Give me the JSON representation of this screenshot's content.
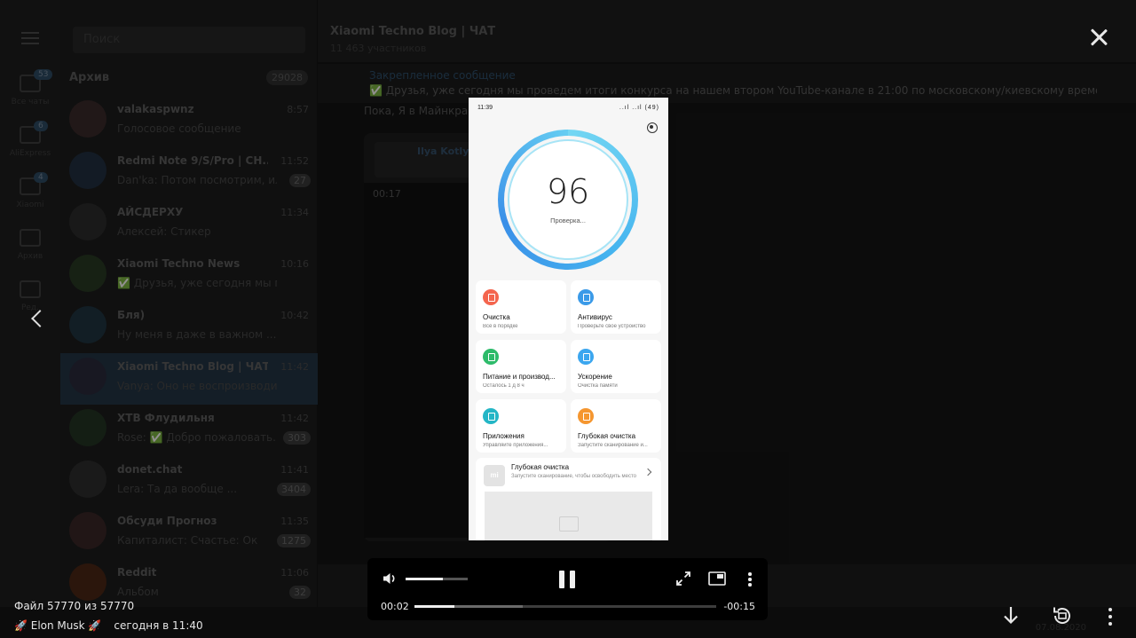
{
  "telegram_background": {
    "sidebar_folders": [
      {
        "label": "Все чаты",
        "badge": "53"
      },
      {
        "label": "AliExpress",
        "badge": "6"
      },
      {
        "label": "Xiaomi",
        "badge": "4"
      },
      {
        "label": "Архив",
        "badge": ""
      },
      {
        "label": "Ред.",
        "badge": ""
      }
    ],
    "search_placeholder": "Поиск",
    "archive_label": "Архив",
    "archive_count": "29028",
    "chats": [
      {
        "name": "valakaspwnz",
        "time": "8:57",
        "message": "Голосовое сообщение",
        "count": ""
      },
      {
        "name": "Redmi Note 9/S/Pro | CH...",
        "time": "11:52",
        "message": "Dan'ka: Потом посмотрим, или...",
        "count": "27"
      },
      {
        "name": "АЙСДЕРХУ",
        "time": "11:34",
        "message": "Алексей: Стикер",
        "count": ""
      },
      {
        "name": "Xiaomi Techno News",
        "time": "10:16",
        "message": "✅ Друзья, уже сегодня мы по...",
        "count": ""
      },
      {
        "name": "Бля)",
        "time": "10:42",
        "message": "Ну меня в даже в важном ...",
        "count": ""
      },
      {
        "name": "Xiaomi Techno Blog | ЧАТ",
        "time": "11:42",
        "message": "Vanya: Оно не воспроизводится",
        "count": ""
      },
      {
        "name": "XTB Флудильня",
        "time": "11:42",
        "message": "Rose: ✅ Добро пожаловать...",
        "count": "303"
      },
      {
        "name": "donet.chat",
        "time": "11:41",
        "message": "Lera: Та да вообще ...",
        "count": "3404"
      },
      {
        "name": "Обсуди Прогноз",
        "time": "11:35",
        "message": "Капиталист: Счастье: Ок",
        "count": "1275"
      },
      {
        "name": "Reddit",
        "time": "11:06",
        "message": "Альбом",
        "count": "32"
      }
    ],
    "chat_title": "Xiaomi Techno Blog | ЧАТ",
    "chat_subtitle": "11 463 участников",
    "pinned_title": "Закрепленное сообщение",
    "pinned_text": "✅ Друзья, уже сегодня мы проведем итоги конкурса на нашем втором YouTube-канале в 21:00 по московскому/киевскому времени. в ...",
    "last_message": "Пока, Я в Майнкрафт",
    "video_author": "Ilya Kotlyar",
    "video_duration": "00:17",
    "taskbar_date": "07.08.2020"
  },
  "video_frame": {
    "status_time": "11:39",
    "signal": "..ıl ..ıl (49)",
    "score": "96",
    "checking_label": "Проверка...",
    "tiles": [
      {
        "title": "Очистка",
        "subtitle": "Всё в порядке",
        "color": "#f4654e"
      },
      {
        "title": "Антивирус",
        "subtitle": "Проверьте свое устройство",
        "color": "#3a9ae8"
      },
      {
        "title": "Питание и производ...",
        "subtitle": "Осталось 1 д 8 ч",
        "color": "#2dbb6a"
      },
      {
        "title": "Ускорение",
        "subtitle": "Очистка памяти",
        "color": "#3ba6ef"
      },
      {
        "title": "Приложения",
        "subtitle": "Управляйте приложения...",
        "color": "#24b6c6"
      },
      {
        "title": "Глубокая очистка",
        "subtitle": "Запустите сканирование и...",
        "color": "#f5962f"
      }
    ],
    "deep_clean": {
      "badge": "mi",
      "title": "Глубокая очистка",
      "subtitle": "Запустите сканирование, чтобы освободить место"
    }
  },
  "player": {
    "current_time": "00:02",
    "remaining_time": "-00:15",
    "progress_fraction": 0.133,
    "buffered_fraction": 0.36,
    "volume_fraction": 0.6
  },
  "viewer": {
    "file_info": "Файл 57770 из 57770",
    "sender": "🚀 Elon Musk 🚀",
    "date": "сегодня в 11:40"
  }
}
